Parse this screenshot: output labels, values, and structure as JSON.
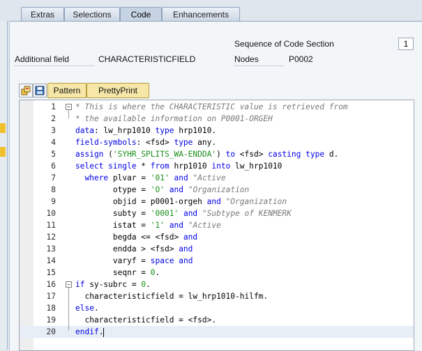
{
  "tabs": [
    {
      "label": "Extras",
      "active": false
    },
    {
      "label": "Selections",
      "active": false
    },
    {
      "label": "Code",
      "active": true
    },
    {
      "label": "Enhancements",
      "active": false
    }
  ],
  "header": {
    "sequence_label": "Sequence of Code Section",
    "sequence_value": "1",
    "additional_field_label": "Additional field",
    "additional_field_value": "CHARACTERISTICFIELD",
    "nodes_label": "Nodes",
    "nodes_value": "P0002"
  },
  "toolbar": {
    "icons": [
      "change-display-icon",
      "save-icon"
    ],
    "pattern_label": "Pattern",
    "prettyprint_label": "PrettyPrint"
  },
  "colors": {
    "keyword": "#0000e6",
    "comment": "#7a7a7a",
    "string": "#1a8f1a",
    "button_bg": "#f6e7a8"
  },
  "editor": {
    "current_line": 20,
    "lines": [
      {
        "n": "1",
        "tokens": [
          [
            "cm",
            "* This is where the CHARACTERISTIC value is retrieved from"
          ]
        ]
      },
      {
        "n": "2",
        "tokens": [
          [
            "cm",
            "* the available information on P0001-ORGEH"
          ]
        ]
      },
      {
        "n": "3",
        "tokens": [
          [
            "kw",
            "data"
          ],
          [
            "pl",
            ": lw_hrp1010 "
          ],
          [
            "kw",
            "type"
          ],
          [
            "pl",
            " hrp1010."
          ]
        ]
      },
      {
        "n": "4",
        "tokens": [
          [
            "kw",
            "field-symbols"
          ],
          [
            "pl",
            ": <fsd> "
          ],
          [
            "kw",
            "type"
          ],
          [
            "pl",
            " any."
          ]
        ]
      },
      {
        "n": "5",
        "tokens": [
          [
            "kw",
            "assign"
          ],
          [
            "pl",
            " ("
          ],
          [
            "st",
            "'SYHR_SPLITS_WA-ENDDA'"
          ],
          [
            "pl",
            ") "
          ],
          [
            "kw",
            "to"
          ],
          [
            "pl",
            " <fsd> "
          ],
          [
            "kw",
            "casting"
          ],
          [
            "pl",
            " "
          ],
          [
            "kw",
            "type"
          ],
          [
            "pl",
            " d."
          ]
        ]
      },
      {
        "n": "6",
        "tokens": [
          [
            "kw",
            "select single"
          ],
          [
            "pl",
            " * "
          ],
          [
            "kw",
            "from"
          ],
          [
            "pl",
            " hrp1010 "
          ],
          [
            "kw",
            "into"
          ],
          [
            "pl",
            " lw_hrp1010"
          ]
        ]
      },
      {
        "n": "7",
        "tokens": [
          [
            "pl",
            "  "
          ],
          [
            "kw",
            "where"
          ],
          [
            "pl",
            " plvar = "
          ],
          [
            "st",
            "'01'"
          ],
          [
            "pl",
            " "
          ],
          [
            "kw",
            "and"
          ],
          [
            "pl",
            " "
          ],
          [
            "cm",
            "\"Active"
          ]
        ]
      },
      {
        "n": "8",
        "tokens": [
          [
            "pl",
            "        otype = "
          ],
          [
            "st",
            "'O'"
          ],
          [
            "pl",
            " "
          ],
          [
            "kw",
            "and"
          ],
          [
            "pl",
            " "
          ],
          [
            "cm",
            "\"Organization"
          ]
        ]
      },
      {
        "n": "9",
        "tokens": [
          [
            "pl",
            "        objid = p0001-orgeh "
          ],
          [
            "kw",
            "and"
          ],
          [
            "pl",
            " "
          ],
          [
            "cm",
            "\"Organization"
          ]
        ]
      },
      {
        "n": "10",
        "tokens": [
          [
            "pl",
            "        subty = "
          ],
          [
            "st",
            "'0001'"
          ],
          [
            "pl",
            " "
          ],
          [
            "kw",
            "and"
          ],
          [
            "pl",
            " "
          ],
          [
            "cm",
            "\"Subtype of KENMERK"
          ]
        ]
      },
      {
        "n": "11",
        "tokens": [
          [
            "pl",
            "        istat = "
          ],
          [
            "st",
            "'1'"
          ],
          [
            "pl",
            " "
          ],
          [
            "kw",
            "and"
          ],
          [
            "pl",
            " "
          ],
          [
            "cm",
            "\"Active"
          ]
        ]
      },
      {
        "n": "12",
        "tokens": [
          [
            "pl",
            "        begda <= <fsd> "
          ],
          [
            "kw",
            "and"
          ]
        ]
      },
      {
        "n": "13",
        "tokens": [
          [
            "pl",
            "        endda > <fsd> "
          ],
          [
            "kw",
            "and"
          ]
        ]
      },
      {
        "n": "14",
        "tokens": [
          [
            "pl",
            "        varyf = "
          ],
          [
            "kw",
            "space"
          ],
          [
            "pl",
            " "
          ],
          [
            "kw",
            "and"
          ]
        ]
      },
      {
        "n": "15",
        "tokens": [
          [
            "pl",
            "        seqnr = "
          ],
          [
            "nm",
            "0"
          ],
          [
            "pl",
            "."
          ]
        ]
      },
      {
        "n": "16",
        "tokens": [
          [
            "kw",
            "if"
          ],
          [
            "pl",
            " sy-subrc = "
          ],
          [
            "nm",
            "0"
          ],
          [
            "pl",
            "."
          ]
        ]
      },
      {
        "n": "17",
        "tokens": [
          [
            "pl",
            "  characteristicfield = lw_hrp1010-hilfm."
          ]
        ]
      },
      {
        "n": "18",
        "tokens": [
          [
            "kw",
            "else"
          ],
          [
            "pl",
            "."
          ]
        ]
      },
      {
        "n": "19",
        "tokens": [
          [
            "pl",
            "  characteristicfield = <fsd>."
          ]
        ]
      },
      {
        "n": "20",
        "tokens": [
          [
            "kw",
            "endif"
          ],
          [
            "pl",
            "."
          ]
        ]
      }
    ]
  }
}
